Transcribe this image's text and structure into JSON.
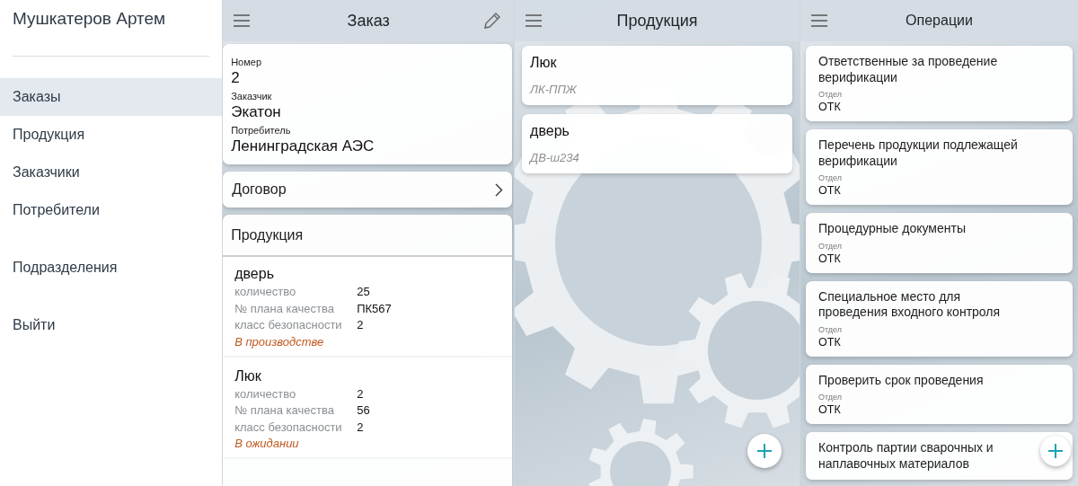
{
  "drawer": {
    "user_name": "Мушкатеров Артем",
    "items": [
      {
        "label": "Заказы",
        "selected": true
      },
      {
        "label": "Продукция",
        "selected": false
      },
      {
        "label": "Заказчики",
        "selected": false
      },
      {
        "label": "Потребители",
        "selected": false
      },
      {
        "label": "Подразделения",
        "selected": false
      },
      {
        "label": "Выйти",
        "selected": false
      }
    ]
  },
  "order_screen": {
    "title": "Заказ",
    "fields": [
      {
        "label": "Номер",
        "value": "2"
      },
      {
        "label": "Заказчик",
        "value": "Экатон"
      },
      {
        "label": "Потребитель",
        "value": "Ленинградская АЭС"
      }
    ],
    "contract_label": "Договор",
    "products_heading": "Продукция",
    "products": [
      {
        "name": "дверь",
        "props": [
          {
            "label": "количество",
            "value": "25"
          },
          {
            "label": "№ плана качества",
            "value": "ПК567"
          },
          {
            "label": "класс безопасности",
            "value": "2"
          }
        ],
        "status": "В производстве"
      },
      {
        "name": "Люк",
        "props": [
          {
            "label": "количество",
            "value": "2"
          },
          {
            "label": "№ плана качества",
            "value": "56"
          },
          {
            "label": "класс безопасности",
            "value": "2"
          }
        ],
        "status": "В ожидании"
      }
    ]
  },
  "products_screen": {
    "title": "Продукция",
    "items": [
      {
        "name": "Люк",
        "code": "ЛК-ППЖ"
      },
      {
        "name": "дверь",
        "code": "ДВ-ш234"
      }
    ]
  },
  "operations_screen": {
    "title": "Операции",
    "items": [
      {
        "title": "Ответственные за проведение верификации",
        "label": "Отдел",
        "value": "ОТК"
      },
      {
        "title": "Перечень продукции подлежащей верификации",
        "label": "Отдел",
        "value": "ОТК"
      },
      {
        "title": "Процедурные документы",
        "label": "Отдел",
        "value": "ОТК"
      },
      {
        "title": "Специальное место для проведения входного контроля",
        "label": "Отдел",
        "value": "ОТК"
      },
      {
        "title": "Проверить срок проведения",
        "label": "Отдел",
        "value": "ОТК"
      },
      {
        "title": "Контроль партии сварочных и наплавочных материалов"
      }
    ]
  }
}
